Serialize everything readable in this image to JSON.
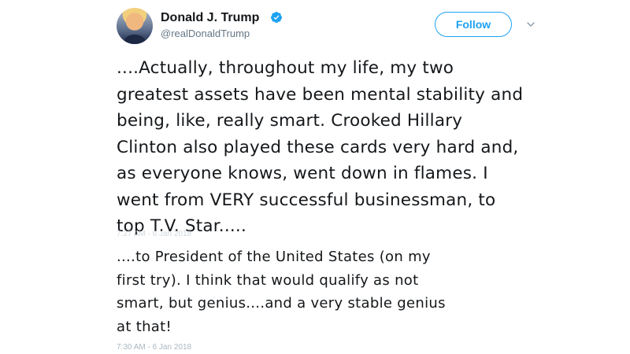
{
  "user": {
    "display_name": "Donald J. Trump",
    "handle": "@realDonaldTrump",
    "verified_icon": "verified-badge-icon"
  },
  "follow_label": "Follow",
  "menu_icon": "chevron-down-icon",
  "tweets": [
    {
      "text": "....Actually, throughout my life, my two\ngreatest assets have been mental stability and\nbeing, like, really smart. Crooked Hillary\nClinton also played these cards very hard and,\nas everyone knows, went down in flames. I\nwent from VERY successful businessman, to\ntop T.V. Star.....",
      "timestamp": "7:27 AM - 6 Jan 2018"
    },
    {
      "text": "....to President of the United States (on my\nfirst try). I think that would qualify as not\nsmart, but genius....and a very stable genius\nat that!",
      "timestamp": "7:30 AM - 6 Jan 2018"
    }
  ],
  "colors": {
    "accent": "#1da1f2",
    "text": "#14171a",
    "muted": "#657786"
  }
}
